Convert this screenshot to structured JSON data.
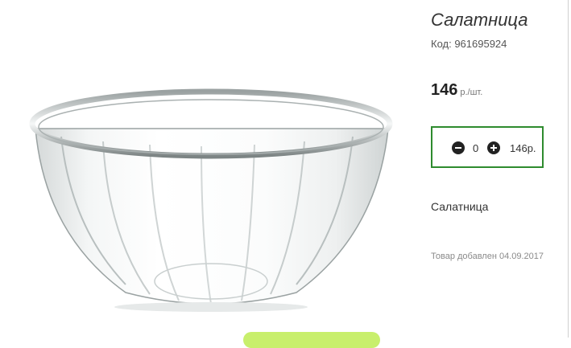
{
  "product": {
    "title": "Салатница",
    "code": "Код: 961695924",
    "price_value": "146",
    "price_unit": "р./шт.",
    "description": "Салатница",
    "added": "Товар добавлен 04.09.2017"
  },
  "quantity": {
    "value": "0",
    "total": "146р."
  },
  "icons": {
    "minus": "minus-circle-icon",
    "plus": "plus-circle-icon"
  },
  "colors": {
    "qty_border": "#2e8b2e",
    "cart_button": "#c8ef6c"
  }
}
